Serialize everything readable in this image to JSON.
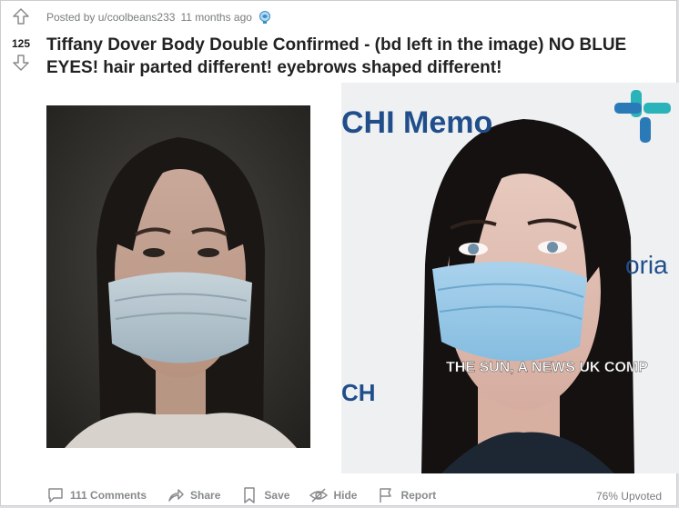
{
  "post": {
    "posted_by": "Posted by u/coolbeans233",
    "age": "11 months ago",
    "score": "125",
    "title": "Tiffany Dover Body Double Confirmed - (bd left in the image) NO BLUE EYES! hair parted different! eyebrows shaped different!",
    "award_icon": "award-icon"
  },
  "images": {
    "right_sign_text": "CHI Memo",
    "right_sign_text_2": "oria",
    "right_caption": "THE SUN, A NEWS UK COMP",
    "right_sign_text_3": "CH"
  },
  "actions": {
    "comments": "111 Comments",
    "share": "Share",
    "save": "Save",
    "hide": "Hide",
    "report": "Report"
  },
  "upvoted": "76% Upvoted",
  "colors": {
    "text": "#222222",
    "meta": "#787c7e",
    "mask_blue": "#9ecae6",
    "chi_blue": "#2a7ab8",
    "chi_teal": "#2ab3b8"
  }
}
